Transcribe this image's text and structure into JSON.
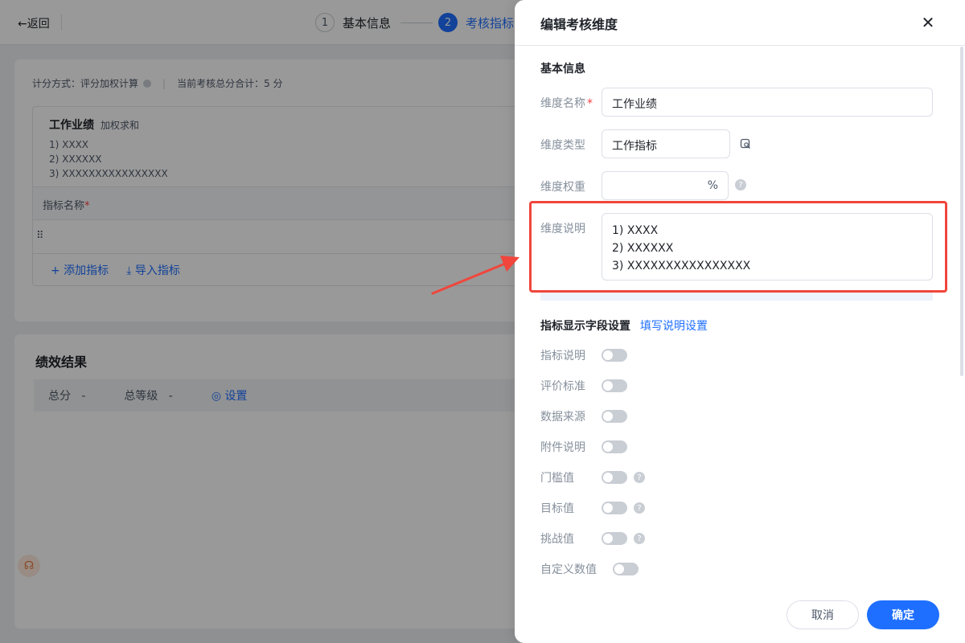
{
  "page": {
    "back_label": "←返回",
    "steps": [
      {
        "num": "1",
        "label": "基本信息"
      },
      {
        "num": "2",
        "label": "考核指标"
      }
    ],
    "summary": {
      "method": "计分方式：评分加权计算",
      "total": "当前考核总分合计：5 分"
    },
    "dimension": {
      "title": "工作业绩",
      "tag": "加权求和",
      "desc_lines": [
        "1) XXXX",
        "2) XXXXXX",
        "3) XXXXXXXXXXXXXXXX"
      ],
      "col_indicator_name": "指标名称",
      "add_indicator": "+ 添加指标",
      "import_indicator": "导入指标"
    },
    "result": {
      "title": "绩效结果",
      "total_score": "总分",
      "total_score_value": "-",
      "total_grade": "总等级",
      "total_grade_value": "-",
      "settings": "设置"
    }
  },
  "drawer": {
    "title": "编辑考核维度",
    "basic_section": "基本信息",
    "name_label": "维度名称",
    "name_value": "工作业绩",
    "type_label": "维度类型",
    "type_value": "工作指标",
    "weight_label": "维度权重",
    "weight_suffix": "%",
    "desc_label": "维度说明",
    "desc_value": "1) XXXX\n2) XXXXXX\n3) XXXXXXXXXXXXXXXX",
    "display_section": "指标显示字段设置",
    "display_link": "填写说明设置",
    "toggles": [
      {
        "label": "指标说明",
        "help": false
      },
      {
        "label": "评价标准",
        "help": false
      },
      {
        "label": "数据来源",
        "help": false
      },
      {
        "label": "附件说明",
        "help": false
      },
      {
        "label": "门槛值",
        "help": true
      },
      {
        "label": "目标值",
        "help": true
      },
      {
        "label": "挑战值",
        "help": true
      },
      {
        "label": "自定义数值",
        "help": false
      }
    ],
    "cancel_label": "取消",
    "ok_label": "确定"
  },
  "colors": {
    "primary": "#1e6fff",
    "annotation": "#f0463c",
    "required": "#f53f3f"
  }
}
